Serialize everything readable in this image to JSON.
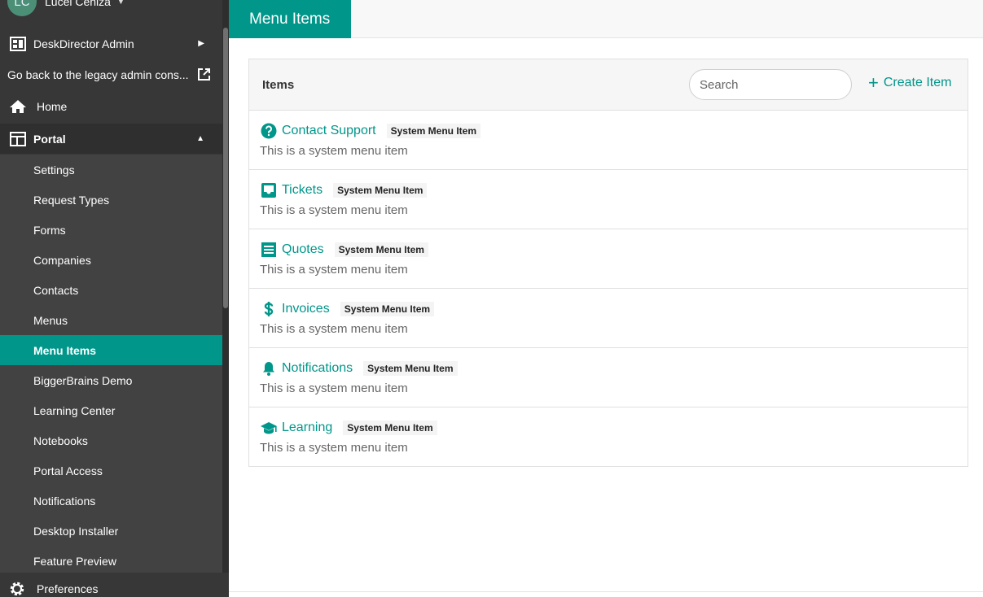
{
  "user": {
    "initials": "LC",
    "name": "Lucel Ceniza"
  },
  "sidebar": {
    "admin_label": "DeskDirector Admin",
    "legacy_label": "Go back to the legacy admin cons...",
    "home_label": "Home",
    "portal_label": "Portal",
    "portal_items": [
      {
        "label": "Settings"
      },
      {
        "label": "Request Types"
      },
      {
        "label": "Forms"
      },
      {
        "label": "Companies"
      },
      {
        "label": "Contacts"
      },
      {
        "label": "Menus"
      },
      {
        "label": "Menu Items",
        "active": true
      },
      {
        "label": "BiggerBrains Demo"
      },
      {
        "label": "Learning Center"
      },
      {
        "label": "Notebooks"
      },
      {
        "label": "Portal Access"
      },
      {
        "label": "Notifications"
      },
      {
        "label": "Desktop Installer"
      },
      {
        "label": "Feature Preview"
      }
    ],
    "preferences_label": "Preferences"
  },
  "header": {
    "page_title": "Menu Items"
  },
  "panel": {
    "title": "Items",
    "search_placeholder": "Search",
    "create_label": "Create Item",
    "items": [
      {
        "title": "Contact Support",
        "badge": "System Menu Item",
        "desc": "This is a system menu item",
        "icon": "help-circle-icon"
      },
      {
        "title": "Tickets",
        "badge": "System Menu Item",
        "desc": "This is a system menu item",
        "icon": "inbox-icon"
      },
      {
        "title": "Quotes",
        "badge": "System Menu Item",
        "desc": "This is a system menu item",
        "icon": "receipt-icon"
      },
      {
        "title": "Invoices",
        "badge": "System Menu Item",
        "desc": "This is a system menu item",
        "icon": "dollar-icon"
      },
      {
        "title": "Notifications",
        "badge": "System Menu Item",
        "desc": "This is a system menu item",
        "icon": "bell-icon"
      },
      {
        "title": "Learning",
        "badge": "System Menu Item",
        "desc": "This is a system menu item",
        "icon": "graduation-cap-icon"
      }
    ]
  },
  "colors": {
    "accent": "#00968a",
    "sidebar_bg": "#373737",
    "subnav_bg": "#424242"
  }
}
